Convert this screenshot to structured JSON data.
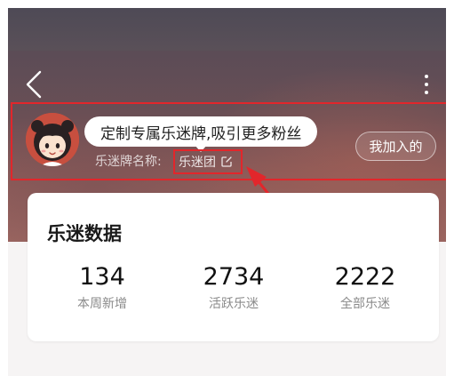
{
  "nav": {
    "back_icon": "chevron-left-icon",
    "more_icon": "more-vertical-icon"
  },
  "fan_club": {
    "tooltip": "定制专属乐迷牌,吸引更多粉丝",
    "name_label": "乐迷牌名称: ",
    "name_value": "乐迷团",
    "edit_icon": "edit-icon",
    "joined_button": "我加入的"
  },
  "stats": {
    "title": "乐迷数据",
    "items": [
      {
        "value": "134",
        "label": "本周新增"
      },
      {
        "value": "2734",
        "label": "活跃乐迷"
      },
      {
        "value": "2222",
        "label": "全部乐迷"
      }
    ]
  },
  "colors": {
    "highlight_red": "#e2262b",
    "avatar_bg": "#c84f3f"
  }
}
